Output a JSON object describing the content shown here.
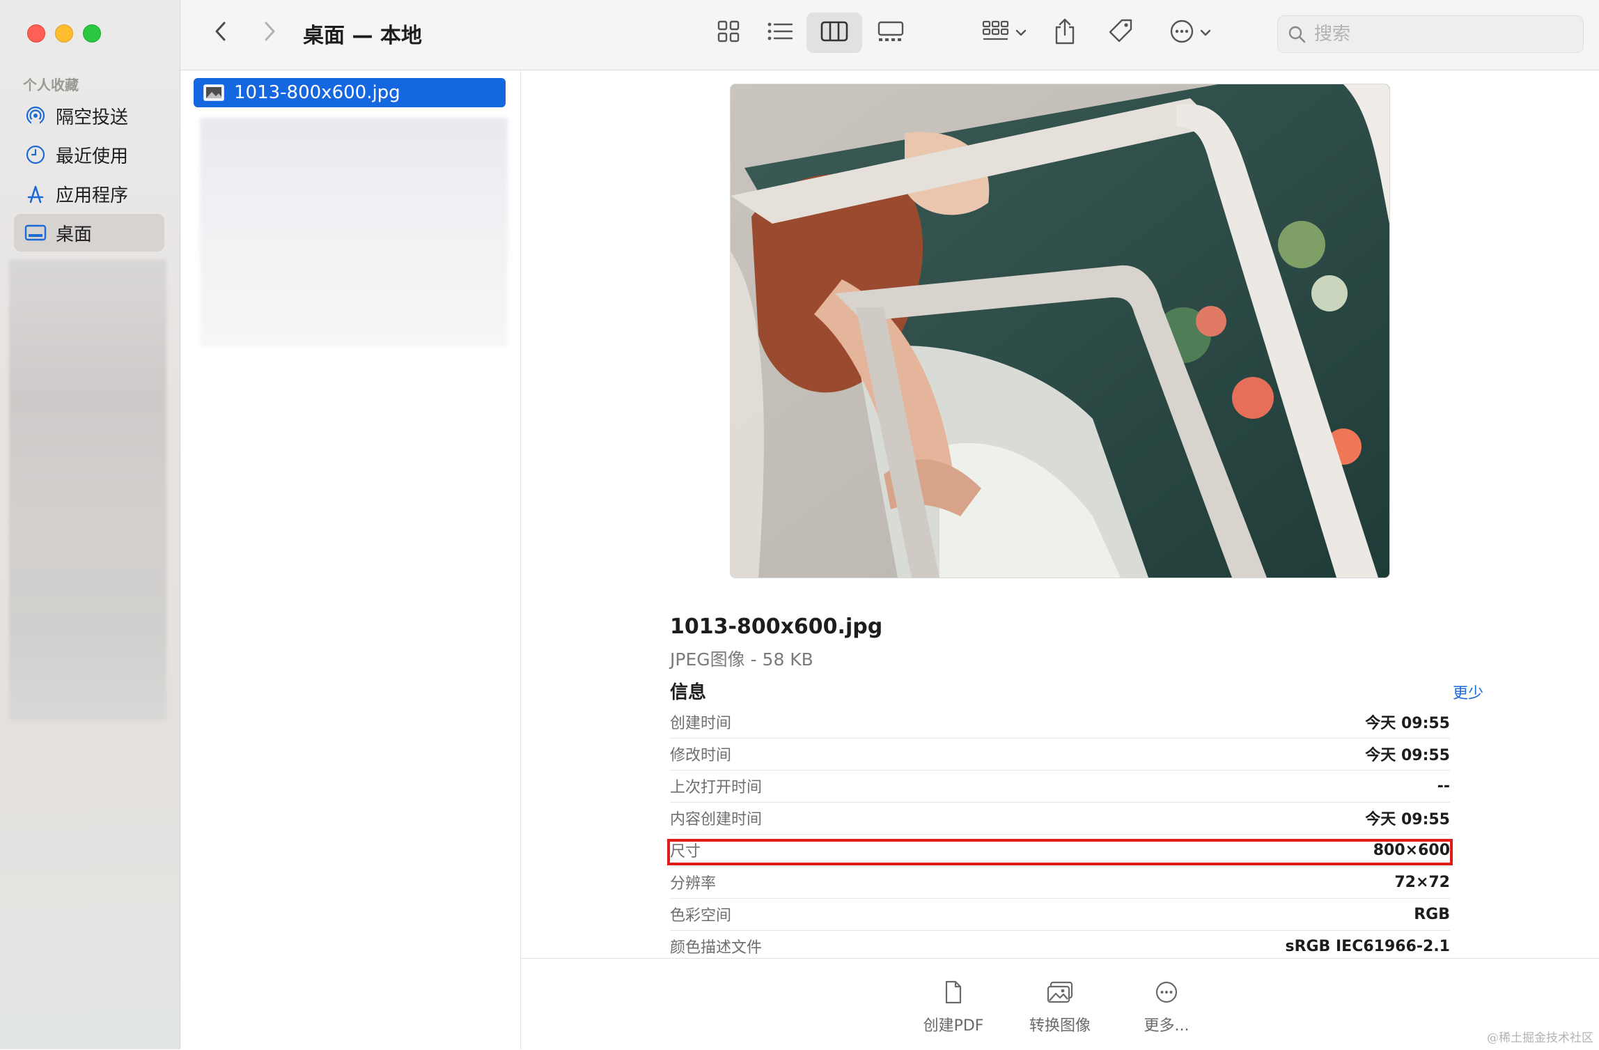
{
  "sidebar": {
    "heading": "个人收藏",
    "items": [
      {
        "label": "隔空投送",
        "icon": "airdrop-icon",
        "selected": false
      },
      {
        "label": "最近使用",
        "icon": "clock-icon",
        "selected": false
      },
      {
        "label": "应用程序",
        "icon": "applications-icon",
        "selected": false
      },
      {
        "label": "桌面",
        "icon": "desktop-icon",
        "selected": true
      }
    ]
  },
  "toolbar": {
    "title": "桌面 — 本地",
    "view_modes": [
      "icon-view",
      "list-view",
      "column-view",
      "gallery-view"
    ],
    "active_view": "column-view",
    "search_placeholder": "搜索"
  },
  "file_list": {
    "selected_file": "1013-800x600.jpg"
  },
  "preview": {
    "file_name": "1013-800x600.jpg",
    "file_kind": "JPEG图像 - 58 KB",
    "info_heading": "信息",
    "less_link": "更少",
    "info": [
      {
        "key": "创建时间",
        "value": "今天 09:55"
      },
      {
        "key": "修改时间",
        "value": "今天 09:55"
      },
      {
        "key": "上次打开时间",
        "value": "--"
      },
      {
        "key": "内容创建时间",
        "value": "今天 09:55"
      },
      {
        "key": "尺寸",
        "value": "800×600",
        "highlighted": true
      },
      {
        "key": "分辨率",
        "value": "72×72"
      },
      {
        "key": "色彩空间",
        "value": "RGB"
      },
      {
        "key": "颜色描述文件",
        "value": "sRGB IEC61966-2.1"
      }
    ]
  },
  "actions": [
    {
      "label": "创建PDF",
      "icon": "document-icon"
    },
    {
      "label": "转换图像",
      "icon": "photos-icon"
    },
    {
      "label": "更多...",
      "icon": "more-icon"
    }
  ],
  "watermark": "@稀土掘金技术社区",
  "colors": {
    "accent": "#1567e0",
    "highlight": "#e11a1a",
    "sidebar_icon": "#1b6ad6"
  }
}
